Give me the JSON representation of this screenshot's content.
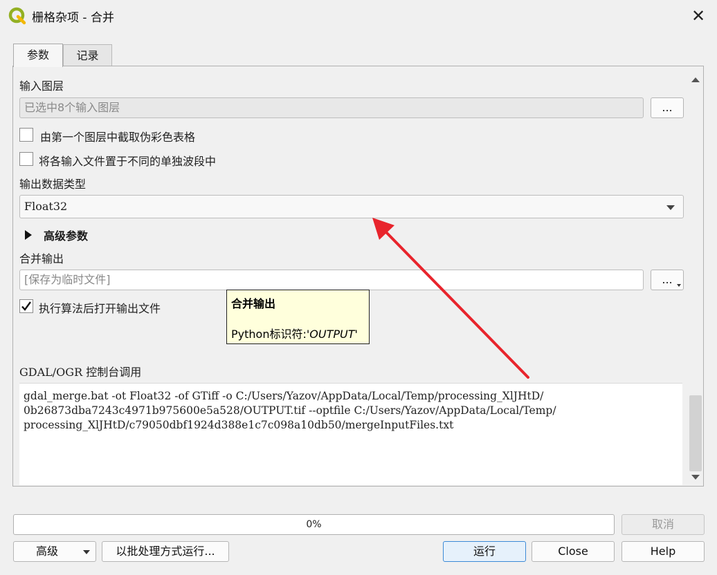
{
  "window": {
    "title": "栅格杂项 - 合并"
  },
  "tabs": [
    {
      "label": "参数"
    },
    {
      "label": "记录"
    }
  ],
  "params": {
    "input_layers_label": "输入图层",
    "input_layers_value": "已选中8个输入图层",
    "browse_label": "...",
    "pct_checkbox_label": "由第一个图层中截取伪彩色表格",
    "pct_checked": false,
    "separate_checkbox_label": "将各输入文件置于不同的单独波段中",
    "separate_checked": false,
    "data_type_label": "输出数据类型",
    "data_type_value": "Float32",
    "advanced_label": "高级参数",
    "output_label": "合并输出",
    "output_placeholder": "[保存为临时文件]",
    "open_output_label": "执行算法后打开输出文件",
    "open_output_checked": true,
    "console_label": "GDAL/OGR 控制台调用",
    "console_lines": [
      "gdal_merge.bat -ot Float32 -of GTiff -o C:/Users/Yazov/AppData/Local/Temp/processing_XlJHtD/",
      "0b26873dba7243c4971b975600e5a528/OUTPUT.tif --optfile C:/Users/Yazov/AppData/Local/Temp/",
      "processing_XlJHtD/c79050dbf1924d388e1c7c098a10db50/mergeInputFiles.txt"
    ]
  },
  "tooltip": {
    "title": "合并输出",
    "id_prefix": "Python标识符:",
    "id_value": "'OUTPUT'"
  },
  "progress": {
    "text": "0%",
    "value": 0
  },
  "buttons": {
    "cancel": "取消",
    "advanced": "高级",
    "batch": "以批处理方式运行...",
    "run": "运行",
    "close": "Close",
    "help": "Help"
  },
  "colors": {
    "annotation_arrow": "#e8242c",
    "tooltip_bg": "#ffffdc",
    "qgis_green": "#93b023"
  }
}
